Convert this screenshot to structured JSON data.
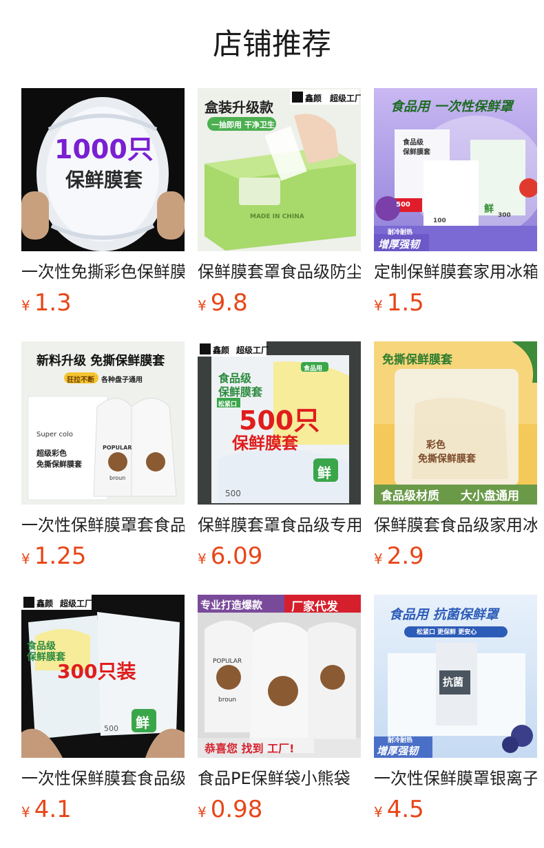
{
  "page": {
    "title": "店铺推荐"
  },
  "products": [
    {
      "name": "一次性免撕彩色保鲜膜套",
      "currency": "¥",
      "price": "1.3",
      "image_text": [
        "1000只",
        "保鲜膜套"
      ]
    },
    {
      "name": "保鲜膜套罩食品级防尘",
      "currency": "¥",
      "price": "9.8",
      "image_text": [
        "盒装升级款",
        "一抽即用 干净卫生",
        "鑫颜",
        "超级工厂",
        "MADE IN CHINA"
      ]
    },
    {
      "name": "定制保鲜膜套家用冰箱",
      "currency": "¥",
      "price": "1.5",
      "image_text": [
        "食品用 一次性保鲜罩",
        "食品级",
        "保鲜膜套",
        "增厚强韧",
        "耐冷耐热",
        "鲜",
        "500",
        "300",
        "100"
      ]
    },
    {
      "name": "一次性保鲜膜罩套食品级",
      "currency": "¥",
      "price": "1.25",
      "image_text": [
        "新料升级 免撕保鲜膜套",
        "狂拉不断",
        "各种盘子通用",
        "Super colo",
        "超级彩色",
        "免撕保鲜膜套",
        "POPULAR",
        "broun"
      ]
    },
    {
      "name": "保鲜膜套罩食品级专用",
      "currency": "¥",
      "price": "6.09",
      "image_text": [
        "鑫颜",
        "超级工厂",
        "食品级",
        "保鲜膜套",
        "松紧口",
        "食品用",
        "500只",
        "保鲜膜套",
        "鲜",
        "500"
      ]
    },
    {
      "name": "保鲜膜套食品级家用冰箱",
      "currency": "¥",
      "price": "2.9",
      "image_text": [
        "免撕保鲜膜套",
        "食品级材质",
        "大小盘通用",
        "彩色",
        "免撕保鲜膜套"
      ]
    },
    {
      "name": "一次性保鲜膜套食品级",
      "currency": "¥",
      "price": "4.1",
      "image_text": [
        "鑫颜",
        "超级工厂",
        "食品级",
        "保鲜膜套",
        "300只装",
        "鲜",
        "500"
      ]
    },
    {
      "name": "食品PE保鲜袋小熊袋",
      "currency": "¥",
      "price": "0.98",
      "image_text": [
        "专业打造爆款",
        "厂家代发",
        "POPULAR",
        "broun",
        "恭喜您 找到 工厂!"
      ]
    },
    {
      "name": "一次性保鲜膜罩银离子",
      "currency": "¥",
      "price": "4.5",
      "image_text": [
        "食品用 抗菌保鲜罩",
        "松紧口 更保鲜 更安心",
        "抗菌",
        "增厚强韧",
        "耐冷耐热"
      ]
    }
  ],
  "colors": {
    "price": "#e84517",
    "title": "#1a1a1a",
    "name": "#222222"
  }
}
